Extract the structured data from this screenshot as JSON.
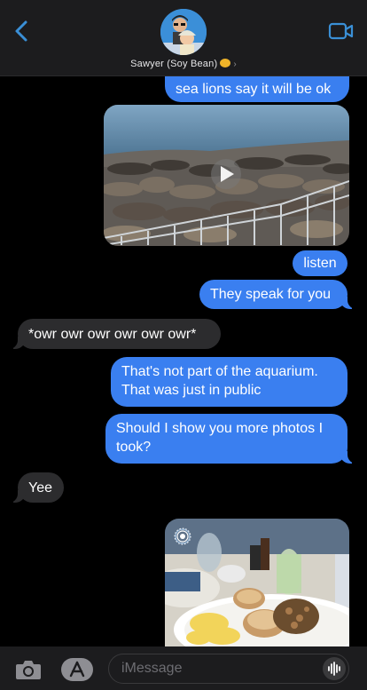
{
  "header": {
    "contact_name": "Sawyer (Soy Bean)",
    "chevron": "›"
  },
  "messages": [
    {
      "type": "text",
      "side": "sent",
      "text": "sea lions say it will be ok"
    },
    {
      "type": "video",
      "side": "sent",
      "description_icon": "play-icon"
    },
    {
      "type": "text",
      "side": "sent",
      "text": "listen"
    },
    {
      "type": "text",
      "side": "sent",
      "text": "They speak for you"
    },
    {
      "type": "text",
      "side": "received",
      "text": "*owr owr owr owr owr owr*"
    },
    {
      "type": "text",
      "side": "sent",
      "lines": [
        "That's not part of the aquarium.",
        "That was just in public"
      ]
    },
    {
      "type": "text",
      "side": "sent",
      "lines": [
        "Should I show you more photos I",
        "took?"
      ]
    },
    {
      "type": "text",
      "side": "received",
      "text": "Yee"
    },
    {
      "type": "photo",
      "side": "sent",
      "icon": "live-photo-icon"
    }
  ],
  "composer": {
    "placeholder": "iMessage"
  },
  "colors": {
    "sent_bubble": "#3a7ff0",
    "received_bubble": "#2c2c2e",
    "accent": "#3a8fd6",
    "background": "#000000"
  }
}
